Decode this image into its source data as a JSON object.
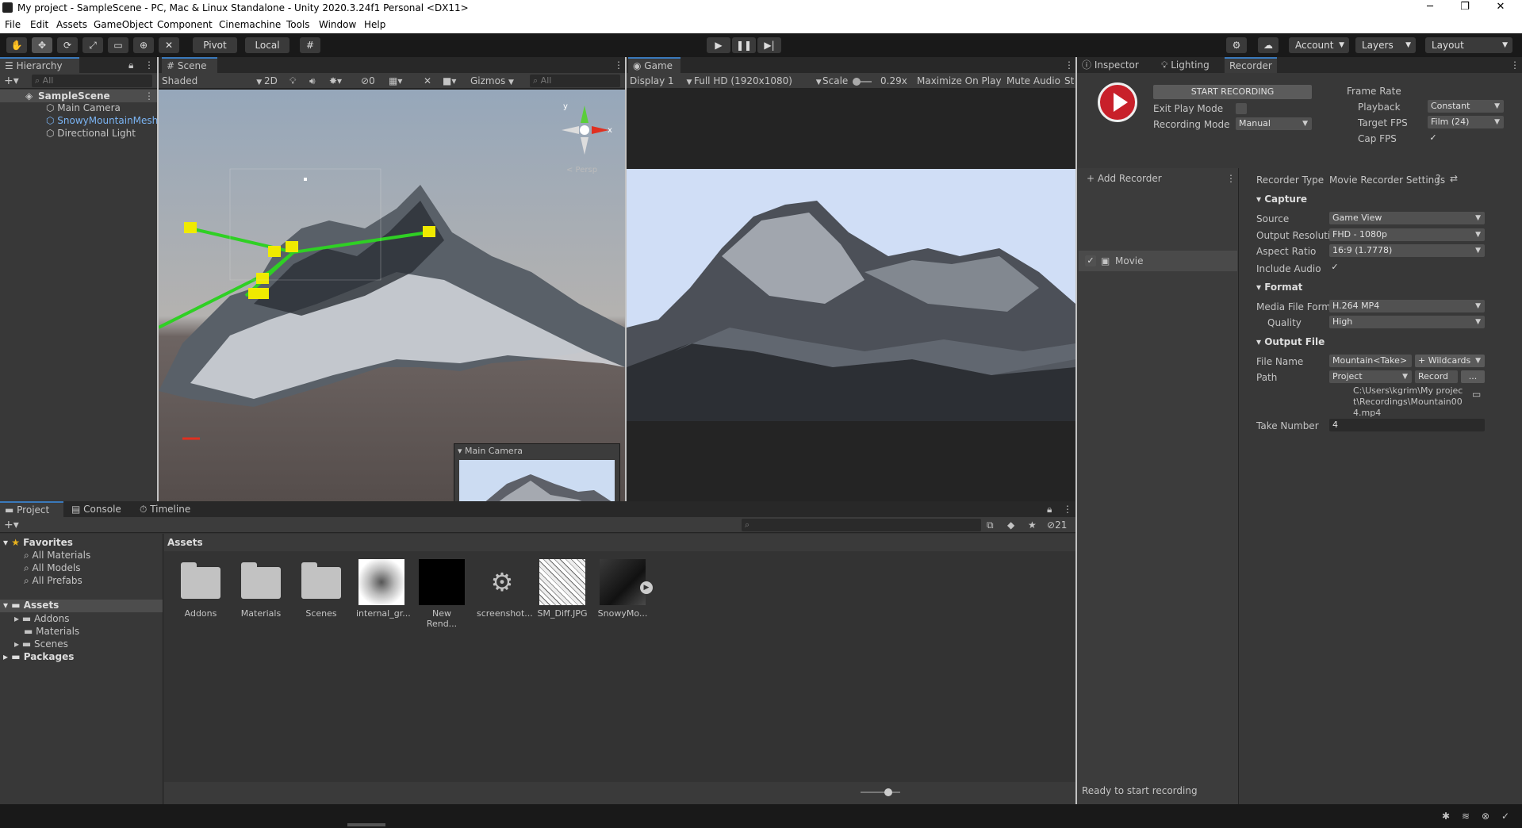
{
  "window": {
    "title": "My project - SampleScene - PC, Mac & Linux Standalone - Unity 2020.3.24f1 Personal <DX11>",
    "min": "─",
    "max": "❐",
    "close": "✕"
  },
  "menu": [
    "File",
    "Edit",
    "Assets",
    "GameObject",
    "Component",
    "Cinemachine",
    "Tools",
    "Window",
    "Help"
  ],
  "toolbar": {
    "pivot": "Pivot",
    "local": "Local",
    "account": "Account",
    "layers": "Layers",
    "layout": "Layout"
  },
  "hierarchy": {
    "tab": "Hierarchy",
    "search_placeholder": "All",
    "scene": "SampleScene",
    "items": [
      "Main Camera",
      "SnowyMountainMesh",
      "Directional Light"
    ]
  },
  "scene": {
    "tab": "Scene",
    "shading": "Shaded",
    "mode2d": "2D",
    "hidden_count": "0",
    "gizmos": "Gizmos",
    "search_placeholder": "All",
    "persp": "< Persp",
    "cam_preview": "Main Camera"
  },
  "game": {
    "tab": "Game",
    "display": "Display 1",
    "resolution": "Full HD (1920x1080)",
    "scale_label": "Scale",
    "scale": "0.29x",
    "maximize": "Maximize On Play",
    "mute": "Mute Audio",
    "stats": "St"
  },
  "inspector": {
    "tabs": [
      "Inspector",
      "Lighting",
      "Recorder"
    ]
  },
  "recorder": {
    "start": "START RECORDING",
    "exit_play": "Exit Play Mode",
    "rec_mode_label": "Recording Mode",
    "rec_mode": "Manual",
    "frame_rate": "Frame Rate",
    "playback_label": "Playback",
    "playback": "Constant",
    "target_fps_label": "Target FPS",
    "target_fps": "Film (24)",
    "cap_fps": "Cap FPS",
    "add_recorder": "+ Add Recorder",
    "movie": "Movie",
    "type_label": "Recorder Type",
    "type": "Movie Recorder Settings",
    "capture": "Capture",
    "source_label": "Source",
    "source": "Game View",
    "out_res_label": "Output Resolution",
    "out_res": "FHD - 1080p",
    "aspect_label": "Aspect Ratio",
    "aspect": "16:9 (1.7778)",
    "include_audio": "Include Audio",
    "format": "Format",
    "media_label": "Media File Format",
    "media": "H.264 MP4",
    "quality_label": "Quality",
    "quality": "High",
    "output_file": "Output File",
    "file_name_label": "File Name",
    "file_name": "Mountain<Take>",
    "wildcards": "+ Wildcards",
    "path_label": "Path",
    "path": "Project",
    "path_record": "Record",
    "path_more": "...",
    "full_path": "C:\\Users\\kgrim\\My project\\Recordings\\Mountain004.mp4",
    "take_label": "Take Number",
    "take": "4",
    "status": "Ready to start recording"
  },
  "project": {
    "tabs": [
      "Project",
      "Console",
      "Timeline"
    ],
    "count": "21",
    "breadcrumb": "Assets",
    "favorites": "Favorites",
    "fav_items": [
      "All Materials",
      "All Models",
      "All Prefabs"
    ],
    "assets": "Assets",
    "asset_folders": [
      "Addons",
      "Materials",
      "Scenes"
    ],
    "packages": "Packages",
    "items": [
      "Addons",
      "Materials",
      "Scenes",
      "internal_gr...",
      "New Rend...",
      "screenshot...",
      "SM_Diff.JPG",
      "SnowyMo..."
    ]
  }
}
